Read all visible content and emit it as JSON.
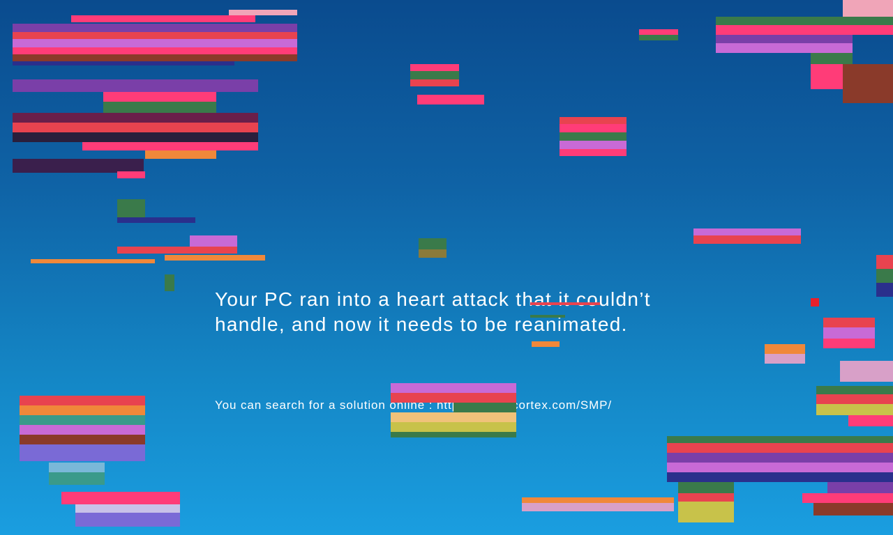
{
  "crash_screen": {
    "message_line_1": "Your PC ran into a heart attack that it couldn’t",
    "message_line_2": "handle, and now it needs to be reanimated.",
    "search_prefix": "You can search for a solution online : ",
    "search_link": "http://www.lecortex.com/SMP/"
  },
  "colors": {
    "background_top": "#0a4b8e",
    "background_bottom": "#1a9ee0",
    "text": "#ffffff",
    "glitch_palette": [
      "#ff3c78",
      "#e8434f",
      "#f0883a",
      "#7a3fa8",
      "#3a7a4a",
      "#c86ad6",
      "#2a2f8c",
      "#f5c27a",
      "#d8a0c8",
      "#8a3a2a"
    ]
  }
}
